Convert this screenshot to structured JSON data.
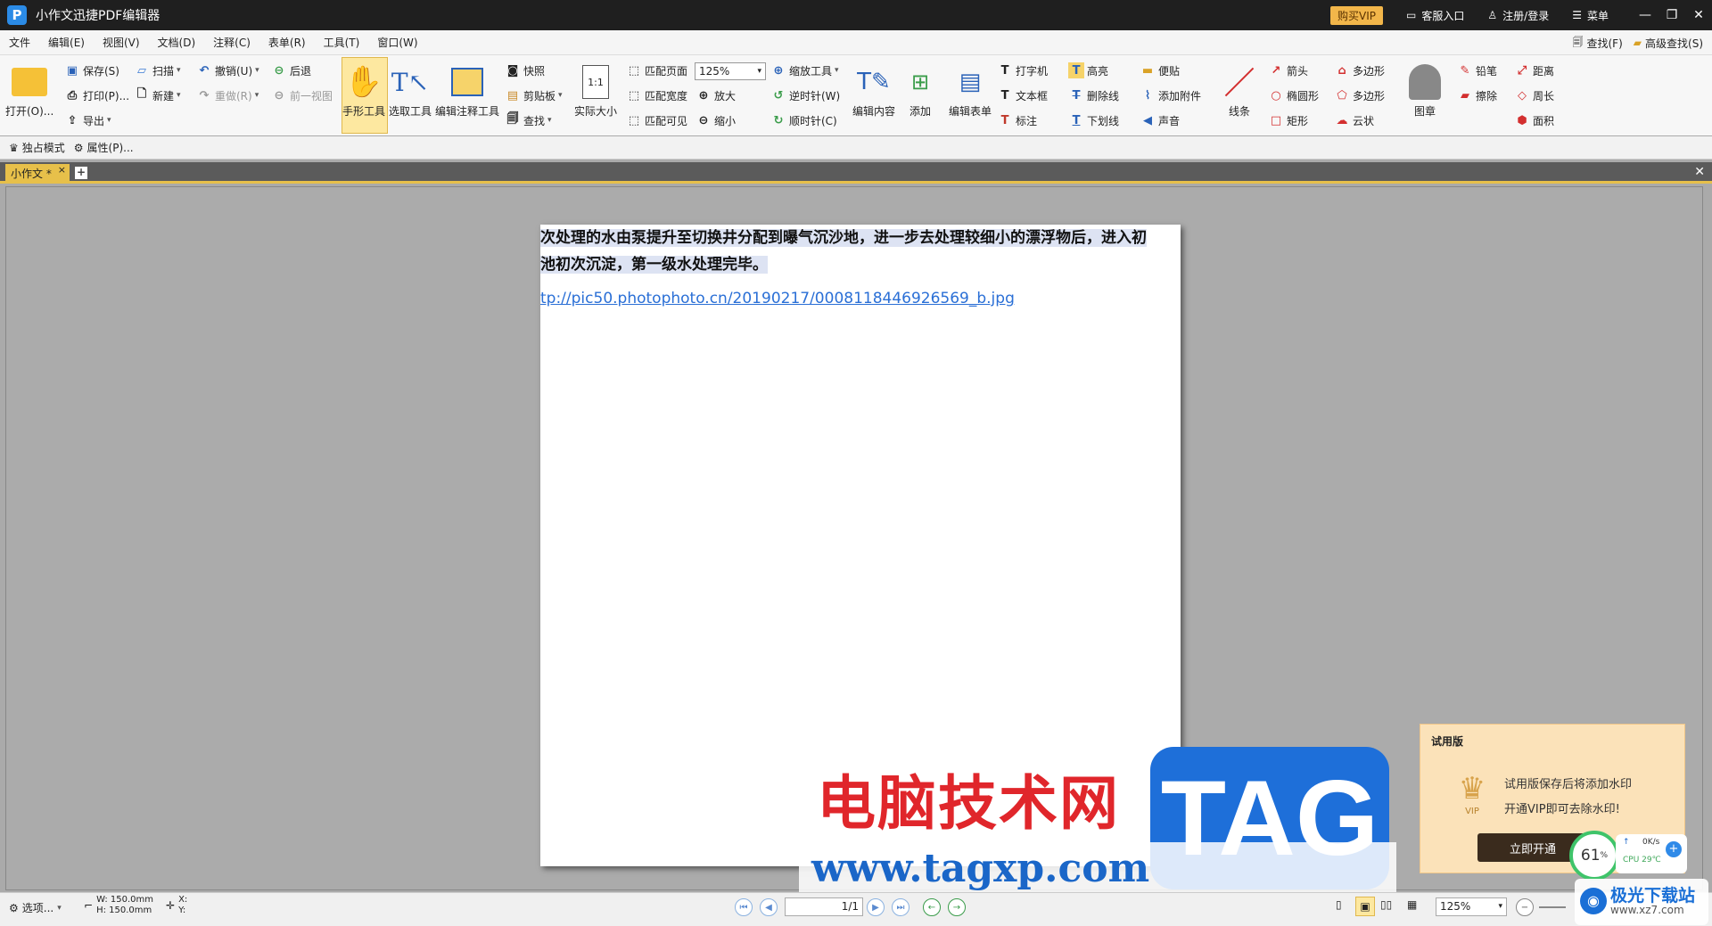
{
  "app": {
    "title": "小作文迅捷PDF编辑器",
    "logo_letter": "P"
  },
  "titlebar": {
    "vip": "购买VIP",
    "service": "客服入口",
    "login": "注册/登录",
    "menu": "菜单"
  },
  "menu": [
    "文件",
    "编辑(E)",
    "视图(V)",
    "文档(D)",
    "注释(C)",
    "表单(R)",
    "工具(T)",
    "窗口(W)"
  ],
  "menu_right": {
    "find": "查找(F)",
    "adv_find": "高级查找(S)"
  },
  "ribbon": {
    "open": "打开(O)...",
    "save": "保存(S)",
    "print": "打印(P)...",
    "export": "导出",
    "scan": "扫描",
    "new": "新建",
    "undo": "撤销(U)",
    "redo": "重做(R)",
    "back": "后退",
    "prev_view": "前一视图",
    "hand": "手形工具",
    "select": "选取工具",
    "edit_annot": "编辑注释工具",
    "snapshot": "快照",
    "clipboard": "剪贴板",
    "find": "查找",
    "actual_size": "实际大小",
    "actual_icon": "1:1",
    "fit_page": "匹配页面",
    "fit_width": "匹配宽度",
    "fit_visible": "匹配可见",
    "zoom_value": "125%",
    "zoom_tool": "缩放工具",
    "ccw": "逆时针(W)",
    "cw": "顺时针(C)",
    "zoom_in": "放大",
    "zoom_out": "缩小",
    "edit_content": "编辑内容",
    "add": "添加",
    "edit_form": "编辑表单",
    "typewriter": "打字机",
    "textbox": "文本框",
    "callout": "标注",
    "highlight": "高亮",
    "strike": "删除线",
    "underline": "下划线",
    "note": "便贴",
    "attach": "添加附件",
    "sound": "声音",
    "line": "线条",
    "arrow": "箭头",
    "ellipse": "椭圆形",
    "rect": "矩形",
    "polygon1": "多边形",
    "polygon2": "多边形",
    "cloud": "云状",
    "stamp": "图章",
    "pencil": "铅笔",
    "eraser": "擦除",
    "distance": "距离",
    "perimeter": "周长",
    "area": "面积"
  },
  "row2": {
    "exclusive": "独占模式",
    "props": "属性(P)..."
  },
  "tab": {
    "name": "小作文 *"
  },
  "document": {
    "line1": "次处理的水由泵提升至切换井分配到曝气沉沙地，进一步去处理较细小的漂浮物后，进入初",
    "line2": "池初次沉淀，第一级水处理完毕。",
    "link": "tp://pic50.photophoto.cn/20190217/0008118446926569_b.jpg"
  },
  "watermark": {
    "cn": "电脑技术网",
    "tag": "TAG",
    "url": "www.tagxp.com"
  },
  "trial": {
    "title": "试用版",
    "msg1": "试用版保存后将添加水印",
    "msg2": "开通VIP即可去除水印!",
    "button": "立即开通",
    "crown_label": "VIP"
  },
  "monitor": {
    "percent": "61",
    "unit": "%",
    "net": "0K/s",
    "cpu": "CPU 29℃"
  },
  "status": {
    "options": "选项...",
    "w": "W: 150.0mm",
    "h": "H: 150.0mm",
    "x": "X:",
    "y": "Y:",
    "page": "1/1",
    "zoom": "125%"
  },
  "brand": {
    "name": "极光下载站",
    "url": "www.xz7.com"
  }
}
